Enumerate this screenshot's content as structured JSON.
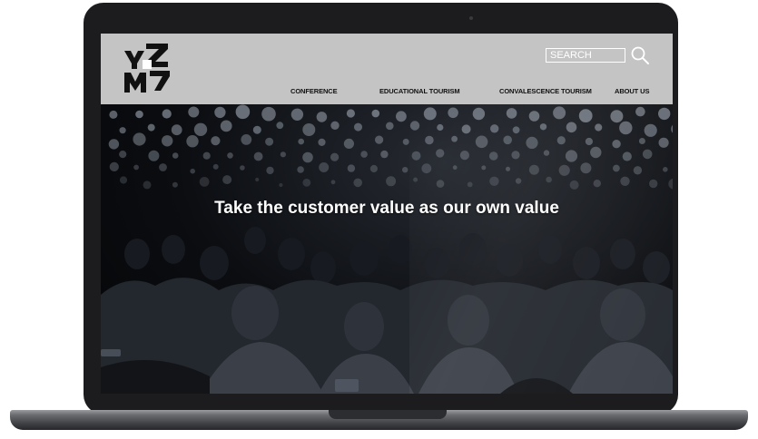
{
  "site": {
    "logo": {
      "alt": "YZM logo",
      "letters": [
        "Y",
        "Z",
        "M",
        "7"
      ]
    },
    "search": {
      "placeholder": "SEARCH",
      "icon": "search-icon"
    },
    "nav": [
      {
        "label": "CONFERENCE"
      },
      {
        "label": "EDUCATIONAL TOURISM"
      },
      {
        "label": "CONVALESCENCE TOURISM"
      },
      {
        "label": "ABOUT US"
      }
    ]
  },
  "hero": {
    "title": "Take the customer value as our own value"
  },
  "colors": {
    "header_bg": "#c4c4c4",
    "hero_bg": "#0b0d11",
    "laptop_frame": "#1c1c1e",
    "text_light": "#ffffff"
  }
}
